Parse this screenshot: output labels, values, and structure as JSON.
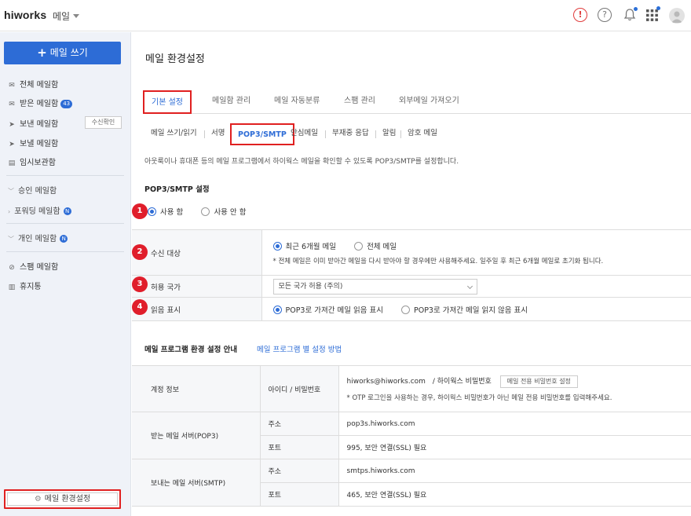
{
  "header": {
    "brand": "hiworks",
    "app_name": "메일",
    "icons": [
      "alert-icon",
      "help-icon",
      "bell-icon",
      "apps-grid-icon",
      "user-avatar-icon"
    ]
  },
  "sidebar": {
    "write_button": "메일 쓰기",
    "items": [
      {
        "label": "전체 메일함",
        "icon": "envelope-icon"
      },
      {
        "label": "받은 메일함",
        "icon": "envelope-icon",
        "badge": "43"
      },
      {
        "label": "보낸 메일함",
        "icon": "send-icon",
        "action": "수신확인"
      },
      {
        "label": "보낼 메일함",
        "icon": "scheduled-send-icon"
      },
      {
        "label": "임시보관함",
        "icon": "draft-icon"
      }
    ],
    "groups": [
      {
        "label": "승인 메일함"
      },
      {
        "label": "포워딩 메일함",
        "badge": "N"
      },
      {
        "label": "개인 메일함",
        "badge": "N"
      }
    ],
    "extra": [
      {
        "label": "스팸 메일함",
        "icon": "ban-icon"
      },
      {
        "label": "휴지통",
        "icon": "trash-icon"
      }
    ],
    "settings_button": "메일 환경설정"
  },
  "main": {
    "title": "메일 환경설정",
    "tabs": [
      "기본 설정",
      "메일함 관리",
      "메일 자동분류",
      "스팸 관리",
      "외부메일 가져오기"
    ],
    "subtabs": [
      "메일 쓰기/읽기",
      "서명",
      "POP3/SMTP",
      "안심메일",
      "부재중 응답",
      "알림",
      "암호 메일"
    ],
    "description": "아웃룩이나 휴대폰 등의 메일 프로그램에서 하이웍스 메일을 확인할 수 있도록 POP3/SMTP를 설정합니다.",
    "section_title": "POP3/SMTP 설정",
    "use_options": [
      "사용 함",
      "사용 안 함"
    ],
    "rows": {
      "receive_target": {
        "label": "수신 대상",
        "options": [
          "최근 6개월 메일",
          "전체 메일"
        ],
        "note": "* 전체 메일은 이미 받아간 메일을 다시 받아야 할 경우에만 사용해주세요. 일주일 후 최근 6개월 메일로 초기화 됩니다."
      },
      "allowed_country": {
        "label": "허용 국가",
        "value": "모든 국가 허용 (주의)"
      },
      "read_mark": {
        "label": "읽음 표시",
        "options": [
          "POP3로 가져간 메일 읽음 표시",
          "POP3로 가져간 메일 읽지 않음 표시"
        ]
      }
    },
    "markers": [
      "1",
      "2",
      "3",
      "4"
    ],
    "guide": {
      "title": "메일 프로그램 환경 설정 안내",
      "link": "메일 프로그램 별 설정 방법",
      "account_label": "계정 정보",
      "id_pw_label": "아이디 / 비밀번호",
      "account_email": "hiworks@hiworks.com",
      "account_pw": "/ 하이웍스 비밀번호",
      "pw_button": "메일 전용 비밀번호 설정",
      "account_note": "* OTP 로그인을 사용하는 경우, 하이웍스 비밀번호가 아닌 메일 전용 비밀번호를 입력해주세요.",
      "pop3_label": "받는 메일 서버(POP3)",
      "smtp_label": "보내는 메일 서버(SMTP)",
      "addr_label": "주소",
      "port_label": "포트",
      "pop3_addr": "pop3s.hiworks.com",
      "pop3_port": "995, 보안 연결(SSL) 필요",
      "smtp_addr": "smtps.hiworks.com",
      "smtp_port": "465, 보안 연결(SSL) 필요"
    }
  },
  "colors": {
    "accent": "#2d6cd6",
    "highlight": "#e02020",
    "marker": "#e01e2b"
  }
}
